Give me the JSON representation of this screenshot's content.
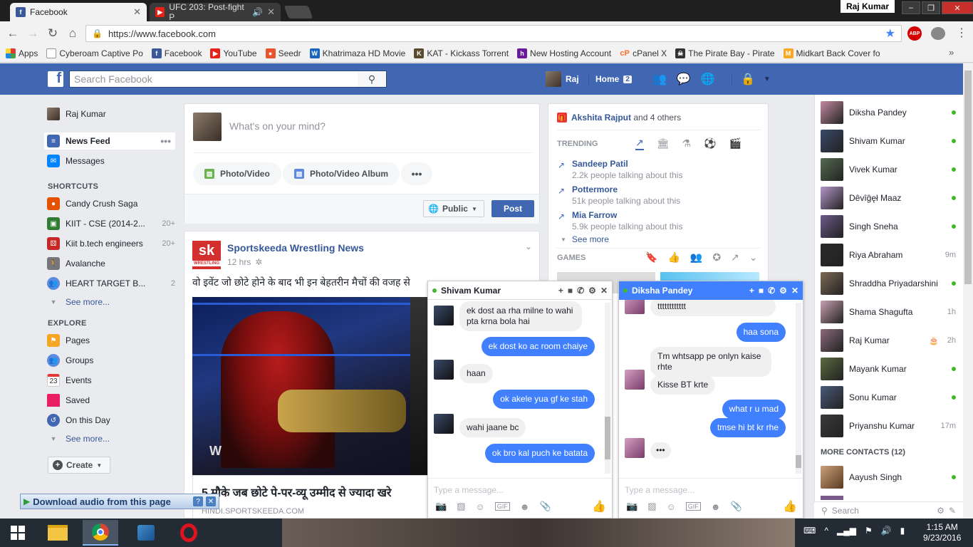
{
  "browser": {
    "tabs": [
      {
        "label": "Facebook",
        "icon": "facebook-icon",
        "active": true
      },
      {
        "label": "UFC 203: Post-fight P",
        "icon": "youtube-icon",
        "active": false
      }
    ],
    "user_chip": "Raj Kumar",
    "url": "https://www.facebook.com",
    "bookmarks": [
      "Apps",
      "Cyberoam Captive Po",
      "Facebook",
      "YouTube",
      "Seedr",
      "Khatrimaza HD Movie",
      "KAT - Kickass Torrent",
      "New Hosting Account",
      "cPanel X",
      "The Pirate Bay - Pirate",
      "Midkart Back Cover fo"
    ],
    "abp": "ABP"
  },
  "header": {
    "search_placeholder": "Search Facebook",
    "profile_name": "Raj",
    "home_label": "Home",
    "home_count": "2"
  },
  "left_nav": {
    "profile_name": "Raj Kumar",
    "news_feed": "News Feed",
    "messages": "Messages",
    "shortcuts_header": "SHORTCUTS",
    "shortcuts": [
      {
        "label": "Candy Crush Saga",
        "count": ""
      },
      {
        "label": "KIIT - CSE (2014-2...",
        "count": "20+"
      },
      {
        "label": "Kiit b.tech engineers",
        "count": "20+"
      },
      {
        "label": "Avalanche",
        "count": ""
      },
      {
        "label": "HEART TARGET B...",
        "count": "2"
      }
    ],
    "see_more": "See more...",
    "explore_header": "EXPLORE",
    "explore": [
      "Pages",
      "Groups",
      "Events",
      "Saved",
      "On this Day"
    ],
    "events_day": "23",
    "see_more_2": "See more...",
    "create": "Create"
  },
  "composer": {
    "placeholder": "What's on your mind?",
    "photo_video": "Photo/Video",
    "photo_album": "Photo/Video Album",
    "privacy": "Public",
    "post": "Post"
  },
  "post": {
    "page_name": "Sportskeeda Wrestling News",
    "logo_text": "sk",
    "logo_sub": "WRESTLING",
    "time": "12 hrs",
    "text": "वो इवेंट जो छोटे होने के बाद भी इन बेहतरीन मैचों की वजह से",
    "link_title": "5 मौके जब छोटे पे-पर-व्यू उम्मीद से ज्यादा खरे",
    "link_domain": "HINDI.SPORTSKEEDA.COM",
    "image_caption": "W"
  },
  "trending": {
    "birthday_name": "Akshita Rajput",
    "birthday_rest": " and 4 others",
    "header": "TRENDING",
    "items": [
      {
        "title": "Sandeep Patil",
        "sub": "2.2k people talking about this"
      },
      {
        "title": "Pottermore",
        "sub": "51k people talking about this"
      },
      {
        "title": "Mia Farrow",
        "sub": "5.9k people talking about this"
      }
    ],
    "see_more": "See more",
    "games_header": "GAMES"
  },
  "chat1": {
    "name": "Shivam Kumar",
    "messages": [
      {
        "dir": "in",
        "text": "ek dost aa rha milne to wahi pta krna bola hai"
      },
      {
        "dir": "out",
        "text": "ek dost ko ac room chaiye"
      },
      {
        "dir": "in",
        "text": "haan"
      },
      {
        "dir": "out",
        "text": "ok akele yua gf ke stah"
      },
      {
        "dir": "in",
        "text": "wahi jaane bc"
      },
      {
        "dir": "out",
        "text": "ok bro kal puch ke batata"
      }
    ],
    "placeholder": "Type a message..."
  },
  "chat2": {
    "name": "Diksha Pandey",
    "messages": [
      {
        "dir": "in",
        "text": "tttttttttttt"
      },
      {
        "dir": "out",
        "text": "haa sona"
      },
      {
        "dir": "in",
        "text": "Tm whtsapp pe onlyn kaise rhte"
      },
      {
        "dir": "in",
        "text": "Kisse BT krte"
      },
      {
        "dir": "out",
        "text": "what r u mad"
      },
      {
        "dir": "out",
        "text": "tmse hi bt kr rhe"
      }
    ],
    "typing": "•••",
    "placeholder": "Type a message..."
  },
  "contacts": [
    {
      "name": "Diksha Pandey",
      "status": "online"
    },
    {
      "name": "Shivam Kumar",
      "status": "online"
    },
    {
      "name": "Vivek Kumar",
      "status": "online"
    },
    {
      "name": "Dêvîĝęł Maaz",
      "status": "online"
    },
    {
      "name": "Singh Sneha",
      "status": "online"
    },
    {
      "name": "Riya Abraham",
      "status": "9m"
    },
    {
      "name": "Shraddha Priyadarshini",
      "status": "online"
    },
    {
      "name": "Shama Shagufta",
      "status": "1h"
    },
    {
      "name": "Raj Kumar",
      "status": "2h"
    },
    {
      "name": "Mayank Kumar",
      "status": "online"
    },
    {
      "name": "Sonu Kumar",
      "status": "online"
    },
    {
      "name": "Priyanshu Kumar",
      "status": "17m"
    }
  ],
  "more_contacts_header": "MORE CONTACTS (12)",
  "more_contacts": [
    {
      "name": "Aayush Singh",
      "status": "online"
    }
  ],
  "sidebar_search": "Search",
  "download_bar": "Download audio from this page",
  "taskbar": {
    "time": "1:15 AM",
    "date": "9/23/2016"
  }
}
